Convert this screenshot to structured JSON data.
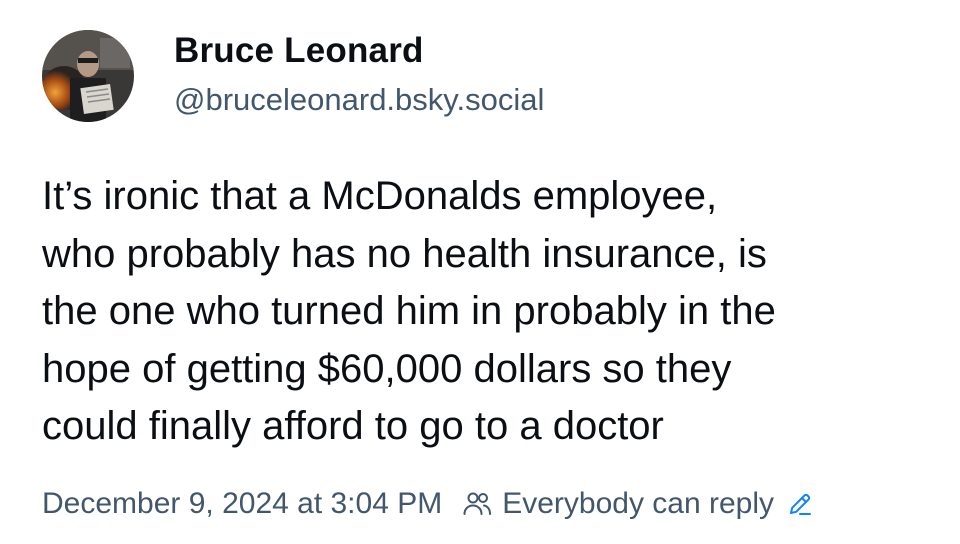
{
  "post": {
    "author": {
      "display_name": "Bruce Leonard",
      "handle": "@bruceleonard.bsky.social"
    },
    "text": "It’s ironic that a McDonalds employee,\nwho probably has no health insurance, is\nthe one who turned him in probably in the\nhope of getting $60,000 dollars so they\ncould finally afford to go to a doctor",
    "timestamp": "December 9, 2024 at 3:04 PM",
    "reply_setting": "Everybody can reply"
  },
  "icons": {
    "reply_setting_icon": "people-icon",
    "edit_icon": "pencil-icon"
  },
  "colors": {
    "text_primary": "#0b0f14",
    "text_secondary": "#42576c",
    "accent": "#1083fe",
    "background": "#ffffff"
  }
}
